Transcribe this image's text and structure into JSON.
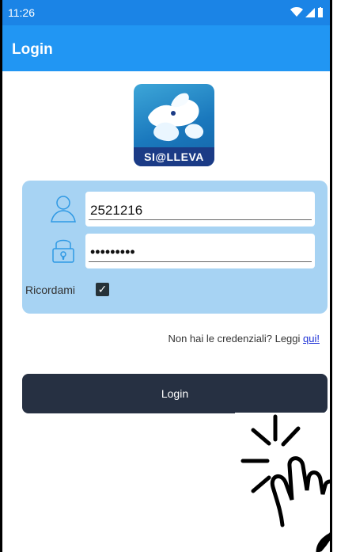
{
  "status_bar": {
    "time": "11:26"
  },
  "app_bar": {
    "title": "Login"
  },
  "logo": {
    "text": "SI@LLEVA"
  },
  "form": {
    "username_value": "2521216",
    "password_value": "•••••••••",
    "remember_label": "Ricordami",
    "remember_checked": true
  },
  "help": {
    "text": "Non hai le credenziali? Leggi",
    "link": "qui!"
  },
  "login_button": {
    "label": "Login"
  },
  "colors": {
    "status_bar": "#1b84e6",
    "app_bar": "#2196f3",
    "panel": "#a7d3f3",
    "button": "#263042"
  }
}
